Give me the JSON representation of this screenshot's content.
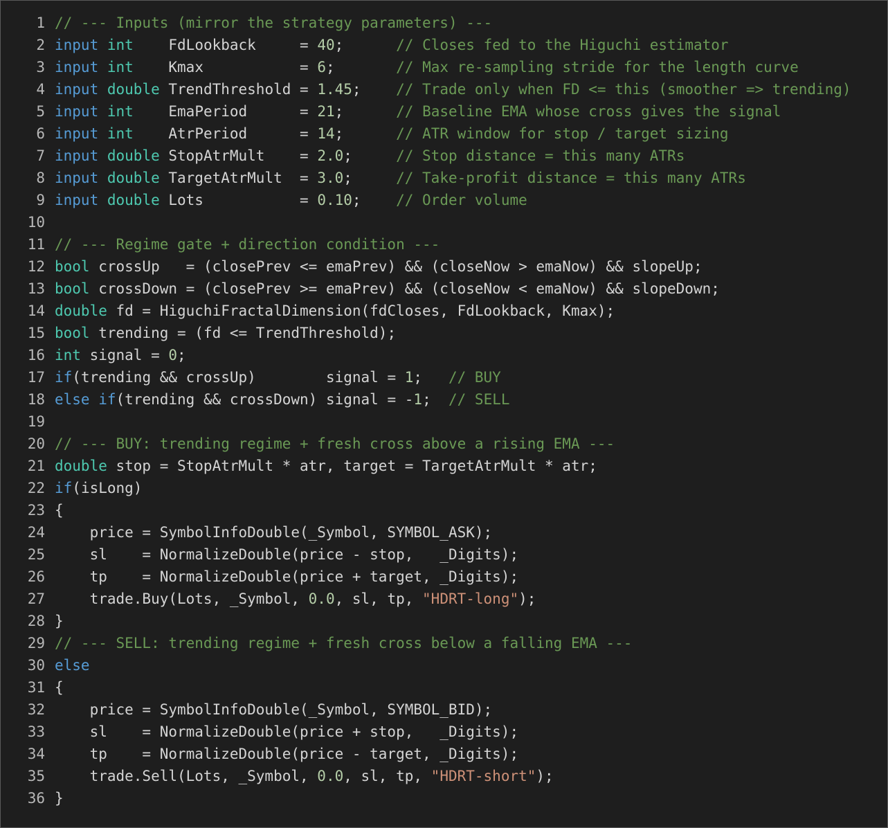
{
  "editor": {
    "colors": {
      "background": "#1e1e1e",
      "line_number": "#b8b8b8",
      "keyword": "#569cd6",
      "type": "#4ec9b0",
      "identifier": "#d4d4d4",
      "number": "#b5cea8",
      "string": "#ce9178",
      "comment": "#6a9955"
    },
    "lines": [
      {
        "n": "1",
        "tokens": [
          [
            "com",
            "// --- Inputs (mirror the strategy parameters) ---"
          ]
        ]
      },
      {
        "n": "2",
        "tokens": [
          [
            "kw",
            "input"
          ],
          [
            "id",
            " "
          ],
          [
            "typ",
            "int"
          ],
          [
            "id",
            "    FdLookback     = "
          ],
          [
            "num",
            "40"
          ],
          [
            "id",
            ";      "
          ],
          [
            "com",
            "// Closes fed to the Higuchi estimator"
          ]
        ]
      },
      {
        "n": "3",
        "tokens": [
          [
            "kw",
            "input"
          ],
          [
            "id",
            " "
          ],
          [
            "typ",
            "int"
          ],
          [
            "id",
            "    Kmax           = "
          ],
          [
            "num",
            "6"
          ],
          [
            "id",
            ";       "
          ],
          [
            "com",
            "// Max re-sampling stride for the length curve"
          ]
        ]
      },
      {
        "n": "4",
        "tokens": [
          [
            "kw",
            "input"
          ],
          [
            "id",
            " "
          ],
          [
            "typ",
            "double"
          ],
          [
            "id",
            " TrendThreshold = "
          ],
          [
            "num",
            "1.45"
          ],
          [
            "id",
            ";    "
          ],
          [
            "com",
            "// Trade only when FD <= this (smoother => trending)"
          ]
        ]
      },
      {
        "n": "5",
        "tokens": [
          [
            "kw",
            "input"
          ],
          [
            "id",
            " "
          ],
          [
            "typ",
            "int"
          ],
          [
            "id",
            "    EmaPeriod      = "
          ],
          [
            "num",
            "21"
          ],
          [
            "id",
            ";      "
          ],
          [
            "com",
            "// Baseline EMA whose cross gives the signal"
          ]
        ]
      },
      {
        "n": "6",
        "tokens": [
          [
            "kw",
            "input"
          ],
          [
            "id",
            " "
          ],
          [
            "typ",
            "int"
          ],
          [
            "id",
            "    AtrPeriod      = "
          ],
          [
            "num",
            "14"
          ],
          [
            "id",
            ";      "
          ],
          [
            "com",
            "// ATR window for stop / target sizing"
          ]
        ]
      },
      {
        "n": "7",
        "tokens": [
          [
            "kw",
            "input"
          ],
          [
            "id",
            " "
          ],
          [
            "typ",
            "double"
          ],
          [
            "id",
            " StopAtrMult    = "
          ],
          [
            "num",
            "2.0"
          ],
          [
            "id",
            ";     "
          ],
          [
            "com",
            "// Stop distance = this many ATRs"
          ]
        ]
      },
      {
        "n": "8",
        "tokens": [
          [
            "kw",
            "input"
          ],
          [
            "id",
            " "
          ],
          [
            "typ",
            "double"
          ],
          [
            "id",
            " TargetAtrMult  = "
          ],
          [
            "num",
            "3.0"
          ],
          [
            "id",
            ";     "
          ],
          [
            "com",
            "// Take-profit distance = this many ATRs"
          ]
        ]
      },
      {
        "n": "9",
        "tokens": [
          [
            "kw",
            "input"
          ],
          [
            "id",
            " "
          ],
          [
            "typ",
            "double"
          ],
          [
            "id",
            " Lots           = "
          ],
          [
            "num",
            "0.10"
          ],
          [
            "id",
            ";    "
          ],
          [
            "com",
            "// Order volume"
          ]
        ]
      },
      {
        "n": "10",
        "tokens": []
      },
      {
        "n": "11",
        "tokens": [
          [
            "com",
            "// --- Regime gate + direction condition ---"
          ]
        ]
      },
      {
        "n": "12",
        "tokens": [
          [
            "typ",
            "bool"
          ],
          [
            "id",
            " crossUp   = (closePrev <= emaPrev) && (closeNow > emaNow) && slopeUp;"
          ]
        ]
      },
      {
        "n": "13",
        "tokens": [
          [
            "typ",
            "bool"
          ],
          [
            "id",
            " crossDown = (closePrev >= emaPrev) && (closeNow < emaNow) && slopeDown;"
          ]
        ]
      },
      {
        "n": "14",
        "tokens": [
          [
            "typ",
            "double"
          ],
          [
            "id",
            " fd = HiguchiFractalDimension(fdCloses, FdLookback, Kmax);"
          ]
        ]
      },
      {
        "n": "15",
        "tokens": [
          [
            "typ",
            "bool"
          ],
          [
            "id",
            " trending = (fd <= TrendThreshold);"
          ]
        ]
      },
      {
        "n": "16",
        "tokens": [
          [
            "typ",
            "int"
          ],
          [
            "id",
            " signal = "
          ],
          [
            "num",
            "0"
          ],
          [
            "id",
            ";"
          ]
        ]
      },
      {
        "n": "17",
        "tokens": [
          [
            "kw",
            "if"
          ],
          [
            "id",
            "(trending && crossUp)        signal = "
          ],
          [
            "num",
            "1"
          ],
          [
            "id",
            ";   "
          ],
          [
            "com",
            "// BUY"
          ]
        ]
      },
      {
        "n": "18",
        "tokens": [
          [
            "kw",
            "else"
          ],
          [
            "id",
            " "
          ],
          [
            "kw",
            "if"
          ],
          [
            "id",
            "(trending && crossDown) signal = -"
          ],
          [
            "num",
            "1"
          ],
          [
            "id",
            ";  "
          ],
          [
            "com",
            "// SELL"
          ]
        ]
      },
      {
        "n": "19",
        "tokens": []
      },
      {
        "n": "20",
        "tokens": [
          [
            "com",
            "// --- BUY: trending regime + fresh cross above a rising EMA ---"
          ]
        ]
      },
      {
        "n": "21",
        "tokens": [
          [
            "typ",
            "double"
          ],
          [
            "id",
            " stop = StopAtrMult * atr, target = TargetAtrMult * atr;"
          ]
        ]
      },
      {
        "n": "22",
        "tokens": [
          [
            "kw",
            "if"
          ],
          [
            "id",
            "(isLong)"
          ]
        ]
      },
      {
        "n": "23",
        "tokens": [
          [
            "id",
            "{"
          ]
        ]
      },
      {
        "n": "24",
        "tokens": [
          [
            "id",
            "    price = SymbolInfoDouble(_Symbol, SYMBOL_ASK);"
          ]
        ]
      },
      {
        "n": "25",
        "tokens": [
          [
            "id",
            "    sl    = NormalizeDouble(price - stop,   _Digits);"
          ]
        ]
      },
      {
        "n": "26",
        "tokens": [
          [
            "id",
            "    tp    = NormalizeDouble(price + target, _Digits);"
          ]
        ]
      },
      {
        "n": "27",
        "tokens": [
          [
            "id",
            "    trade.Buy(Lots, _Symbol, "
          ],
          [
            "num",
            "0.0"
          ],
          [
            "id",
            ", sl, tp, "
          ],
          [
            "str",
            "\"HDRT-long\""
          ],
          [
            "id",
            ");"
          ]
        ]
      },
      {
        "n": "28",
        "tokens": [
          [
            "id",
            "}"
          ]
        ]
      },
      {
        "n": "29",
        "tokens": [
          [
            "com",
            "// --- SELL: trending regime + fresh cross below a falling EMA ---"
          ]
        ]
      },
      {
        "n": "30",
        "tokens": [
          [
            "kw",
            "else"
          ]
        ]
      },
      {
        "n": "31",
        "tokens": [
          [
            "id",
            "{"
          ]
        ]
      },
      {
        "n": "32",
        "tokens": [
          [
            "id",
            "    price = SymbolInfoDouble(_Symbol, SYMBOL_BID);"
          ]
        ]
      },
      {
        "n": "33",
        "tokens": [
          [
            "id",
            "    sl    = NormalizeDouble(price + stop,   _Digits);"
          ]
        ]
      },
      {
        "n": "34",
        "tokens": [
          [
            "id",
            "    tp    = NormalizeDouble(price - target, _Digits);"
          ]
        ]
      },
      {
        "n": "35",
        "tokens": [
          [
            "id",
            "    trade.Sell(Lots, _Symbol, "
          ],
          [
            "num",
            "0.0"
          ],
          [
            "id",
            ", sl, tp, "
          ],
          [
            "str",
            "\"HDRT-short\""
          ],
          [
            "id",
            ");"
          ]
        ]
      },
      {
        "n": "36",
        "tokens": [
          [
            "id",
            "}"
          ]
        ]
      }
    ]
  }
}
